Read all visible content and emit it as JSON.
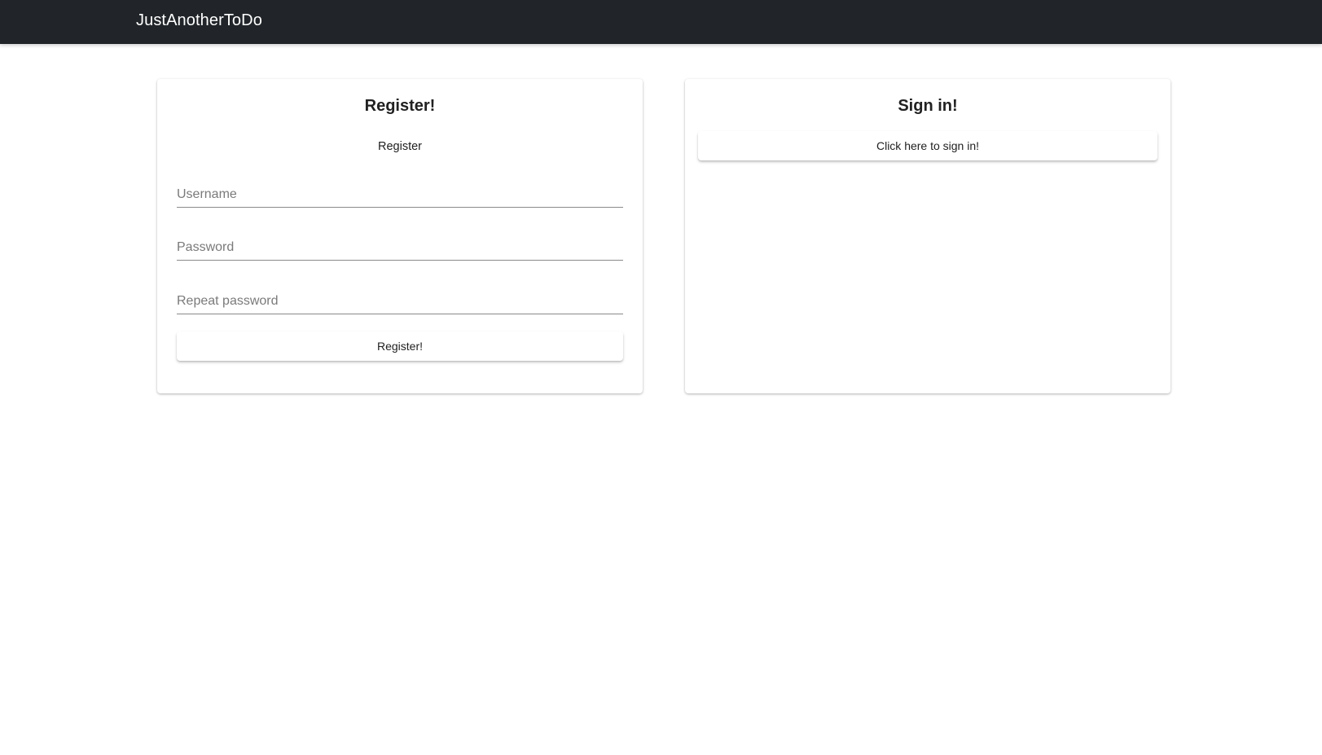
{
  "navbar": {
    "brand": "JustAnotherToDo",
    "background_color": "#212529"
  },
  "register_card": {
    "title": "Register!",
    "subtitle": "Register",
    "fields": {
      "username": {
        "placeholder": "Username",
        "value": ""
      },
      "password": {
        "placeholder": "Password",
        "value": ""
      },
      "repeat_password": {
        "placeholder": "Repeat password",
        "value": ""
      }
    },
    "submit_label": "Register!"
  },
  "signin_card": {
    "title": "Sign in!",
    "button_label": "Click here to sign in!"
  }
}
